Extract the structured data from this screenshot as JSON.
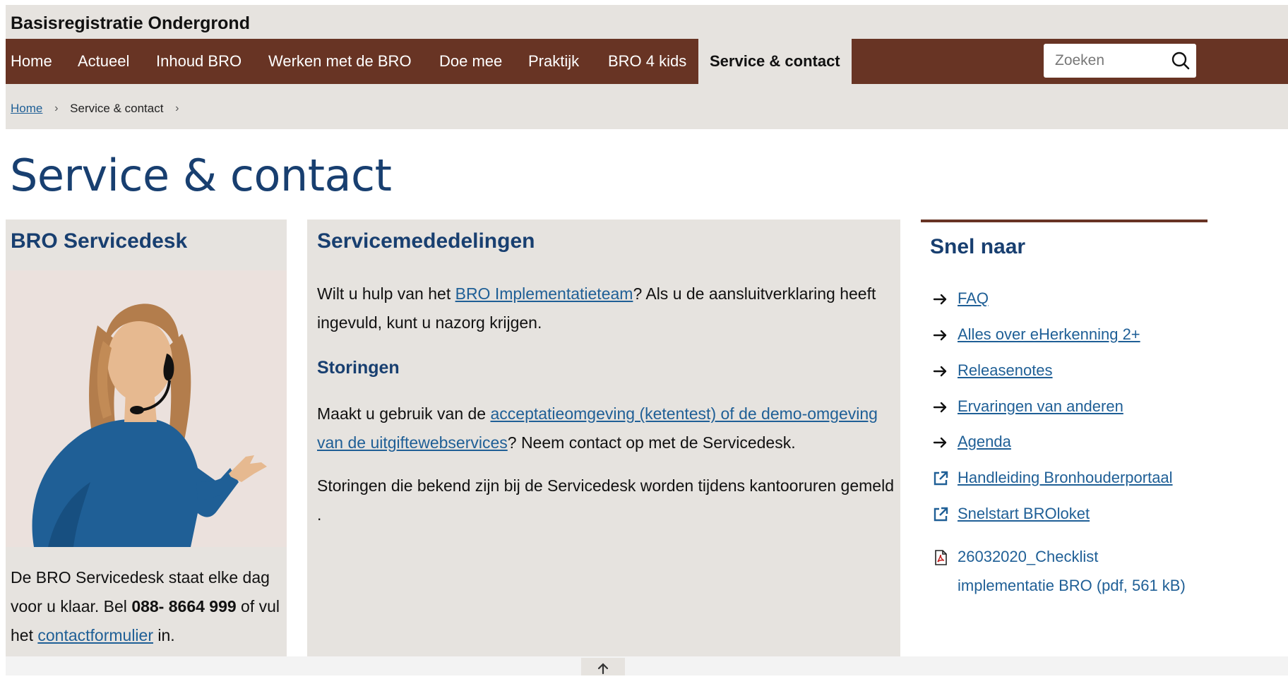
{
  "header": {
    "site_title": "Basisregistratie Ondergrond"
  },
  "nav": {
    "items": [
      {
        "label": "Home"
      },
      {
        "label": "Actueel"
      },
      {
        "label": "Inhoud BRO"
      },
      {
        "label": "Werken met de BRO"
      },
      {
        "label": "Doe mee"
      },
      {
        "label": "Praktijk"
      },
      {
        "label": "BRO 4 kids"
      },
      {
        "label": "Service & contact",
        "active": true
      }
    ],
    "search_placeholder": "Zoeken"
  },
  "breadcrumb": {
    "items": [
      "Home",
      "Service & contact"
    ]
  },
  "page": {
    "title": "Service & contact"
  },
  "servicedesk": {
    "heading": "BRO Servicedesk",
    "text_1": "De BRO Servicedesk staat elke dag voor u klaar. Bel ",
    "phone": "088- 8664 999",
    "text_2": " of vul het ",
    "link": "contactformulier",
    "text_3": " in."
  },
  "announcements": {
    "heading": "Servicemededelingen",
    "p1_text_1": "Wilt u hulp van het ",
    "p1_link": "BRO Implementatieteam",
    "p1_text_2": "? Als u de aansluitverklaring heeft ingevuld, kunt u nazorg krijgen.",
    "sub_heading": "Storingen",
    "p2_text_1": "Maakt u gebruik van de ",
    "p2_link": "acceptatieomgeving (ketentest) of de demo-omgeving van de uitgiftewebservices",
    "p2_text_2": "? Neem contact op met de Servicedesk.",
    "p3": "Storingen die bekend zijn bij de Servicedesk worden tijdens kantooruren gemeld ."
  },
  "quick_links": {
    "heading": "Snel naar",
    "items": [
      {
        "label": "FAQ",
        "icon": "arrow-right-icon"
      },
      {
        "label": "Alles over eHerkenning 2+",
        "icon": "arrow-right-icon"
      },
      {
        "label": "Releasenotes",
        "icon": "arrow-right-icon"
      },
      {
        "label": "Ervaringen van anderen",
        "icon": "arrow-right-icon"
      },
      {
        "label": "Agenda",
        "icon": "arrow-right-icon"
      },
      {
        "label": "Handleiding Bronhouderportaal",
        "icon": "external-link-icon"
      },
      {
        "label": "Snelstart BROloket",
        "icon": "external-link-icon"
      },
      {
        "label": "26032020_Checklist implementatie BRO (pdf, 561 kB)",
        "icon": "pdf-icon"
      }
    ]
  },
  "colors": {
    "nav_bg": "#683424",
    "header_bg": "#e6e3df",
    "heading_blue": "#183f70",
    "link_blue": "#1f5f96",
    "illustration_shirt": "#1f5f96"
  }
}
